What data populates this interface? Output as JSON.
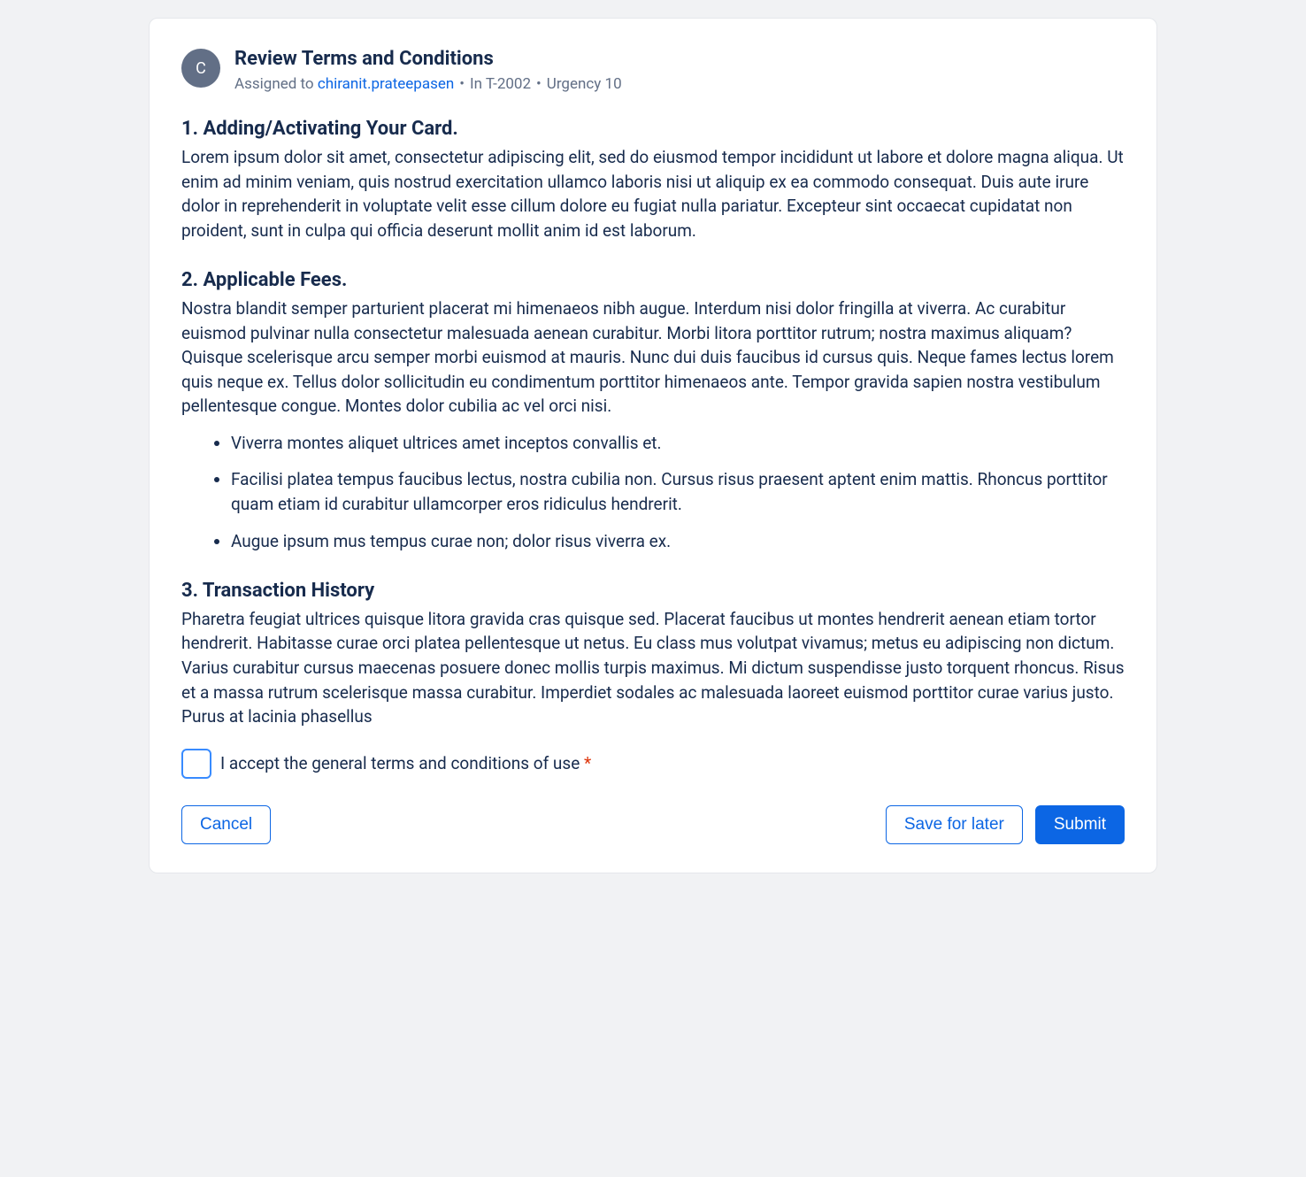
{
  "header": {
    "avatar_letter": "C",
    "title": "Review Terms and Conditions",
    "assigned_prefix": "Assigned to ",
    "assignee": "chiranit.prateepasen",
    "ticket": "In T-2002",
    "urgency": "Urgency 10"
  },
  "sections": [
    {
      "heading": "1. Adding/Activating Your Card.",
      "body": "Lorem ipsum dolor sit amet, consectetur adipiscing elit, sed do eiusmod tempor incididunt ut labore et dolore magna aliqua. Ut enim ad minim veniam, quis nostrud exercitation ullamco laboris nisi ut aliquip ex ea commodo consequat. Duis aute irure dolor in reprehenderit in voluptate velit esse cillum dolore eu fugiat nulla pariatur. Excepteur sint occaecat cupidatat non proident, sunt in culpa qui officia deserunt mollit anim id est laborum."
    },
    {
      "heading": "2. Applicable Fees.",
      "body": "Nostra blandit semper parturient placerat mi himenaeos nibh augue. Interdum nisi dolor fringilla at viverra. Ac curabitur euismod pulvinar nulla consectetur malesuada aenean curabitur. Morbi litora porttitor rutrum; nostra maximus aliquam? Quisque scelerisque arcu semper morbi euismod at mauris. Nunc dui duis faucibus id cursus quis. Neque fames lectus lorem quis neque ex. Tellus dolor sollicitudin eu condimentum porttitor himenaeos ante. Tempor gravida sapien nostra vestibulum pellentesque congue. Montes dolor cubilia ac vel orci nisi.",
      "bullets": [
        "Viverra montes aliquet ultrices amet inceptos convallis et.",
        "Facilisi platea tempus faucibus lectus, nostra cubilia non. Cursus risus praesent aptent enim mattis. Rhoncus porttitor quam etiam id curabitur ullamcorper eros ridiculus hendrerit.",
        "Augue ipsum mus tempus curae non; dolor risus viverra ex."
      ]
    },
    {
      "heading": "3. Transaction History",
      "body": "Pharetra feugiat ultrices quisque litora gravida cras quisque sed. Placerat faucibus ut montes hendrerit aenean etiam tortor hendrerit. Habitasse curae orci platea pellentesque ut netus. Eu class mus volutpat vivamus; metus eu adipiscing non dictum. Varius curabitur cursus maecenas posuere donec mollis turpis maximus. Mi dictum suspendisse justo torquent rhoncus. Risus et a massa rutrum scelerisque massa curabitur. Imperdiet sodales ac malesuada laoreet euismod porttitor curae varius justo. Purus at lacinia phasellus"
    }
  ],
  "accept": {
    "label": "I accept the general terms and conditions of use ",
    "required_mark": "*"
  },
  "buttons": {
    "cancel": "Cancel",
    "save": "Save for later",
    "submit": "Submit"
  }
}
